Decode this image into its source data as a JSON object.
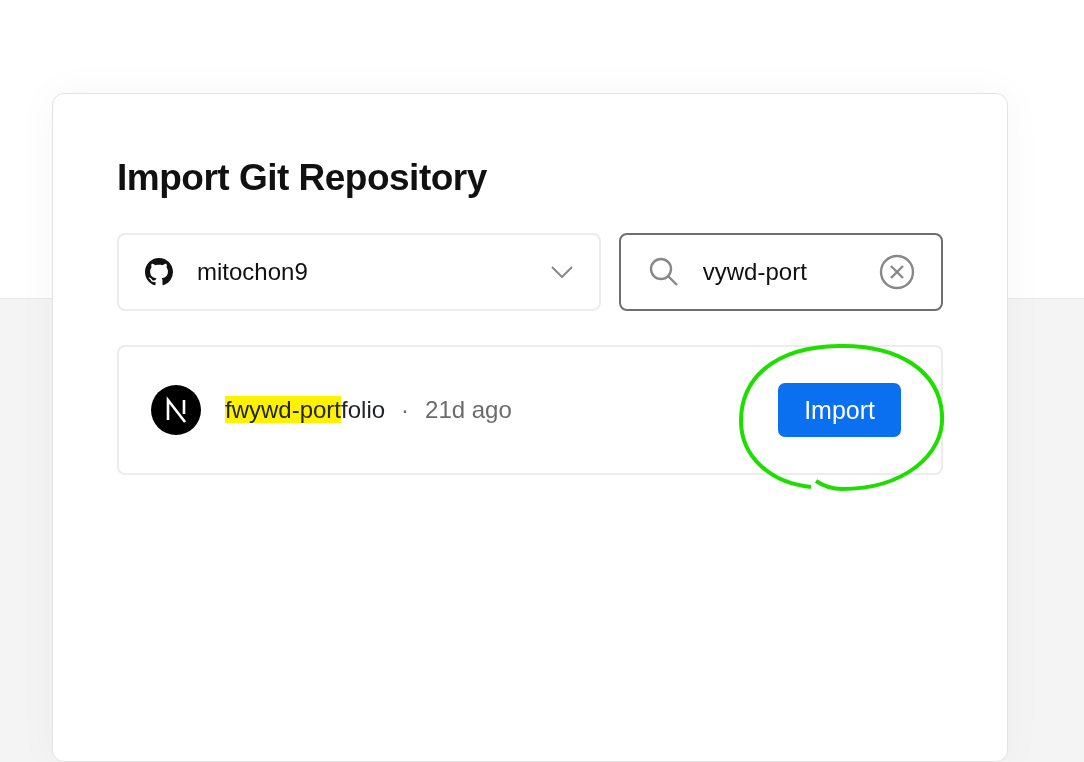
{
  "title": "Import Git Repository",
  "account_select": {
    "value": "mitochon9"
  },
  "search": {
    "value": "vywd-port"
  },
  "repositories": [
    {
      "name_parts": [
        {
          "text": "fwywd-port",
          "highlighted": true
        },
        {
          "text": "folio",
          "highlighted": false
        }
      ],
      "separator": "·",
      "age": "21d ago",
      "button": "Import",
      "annotated": true
    }
  ]
}
